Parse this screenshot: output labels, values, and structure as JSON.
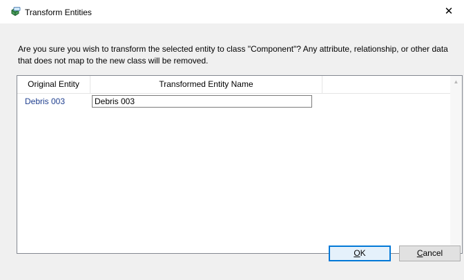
{
  "window": {
    "title": "Transform Entities",
    "close_symbol": "✕"
  },
  "message": "Are you sure you wish to transform the selected entity to class \"Component\"? Any attribute, relationship, or other data that does not map to the new class will be removed.",
  "table": {
    "columns": [
      "Original Entity",
      "Transformed Entity Name"
    ],
    "rows": [
      {
        "original": "Debris 003",
        "transformed": "Debris 003"
      }
    ]
  },
  "buttons": {
    "ok": {
      "label": "OK",
      "mnemonic": "O",
      "rest": "K"
    },
    "cancel": {
      "label": "Cancel",
      "mnemonic": "C",
      "rest": "ancel"
    }
  },
  "icons": {
    "title_icon": "transform-entities-icon",
    "scroll_up": "scroll-up-arrow-icon",
    "scroll_down": "scroll-down-arrow-icon"
  },
  "colors": {
    "accent": "#0078d7",
    "link_text": "#1f3f8f",
    "background": "#f0f0f0"
  }
}
